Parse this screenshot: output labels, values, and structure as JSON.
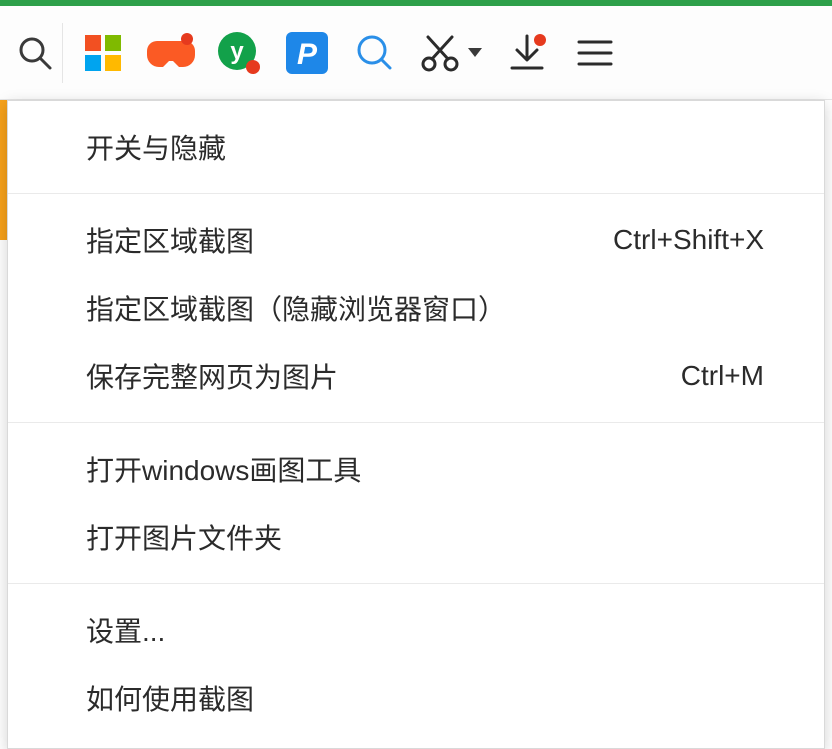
{
  "toolbar": {
    "icons": {
      "search": "search-icon",
      "tiles": "windows-tiles-icon",
      "gamepad": "gamepad-icon",
      "y_badge": "y-circle-icon",
      "p_badge": "p-square-icon",
      "circle_search": "circle-search-icon",
      "scissors": "scissors-icon",
      "download": "download-icon",
      "hamburger": "hamburger-icon"
    }
  },
  "menu": {
    "sections": [
      {
        "items": [
          {
            "label": "开关与隐藏",
            "shortcut": ""
          }
        ]
      },
      {
        "items": [
          {
            "label": "指定区域截图",
            "shortcut": "Ctrl+Shift+X"
          },
          {
            "label": "指定区域截图（隐藏浏览器窗口）",
            "shortcut": ""
          },
          {
            "label": "保存完整网页为图片",
            "shortcut": "Ctrl+M"
          }
        ]
      },
      {
        "items": [
          {
            "label": "打开windows画图工具",
            "shortcut": ""
          },
          {
            "label": "打开图片文件夹",
            "shortcut": ""
          }
        ]
      },
      {
        "items": [
          {
            "label": "设置...",
            "shortcut": ""
          },
          {
            "label": "如何使用截图",
            "shortcut": ""
          }
        ]
      }
    ]
  }
}
